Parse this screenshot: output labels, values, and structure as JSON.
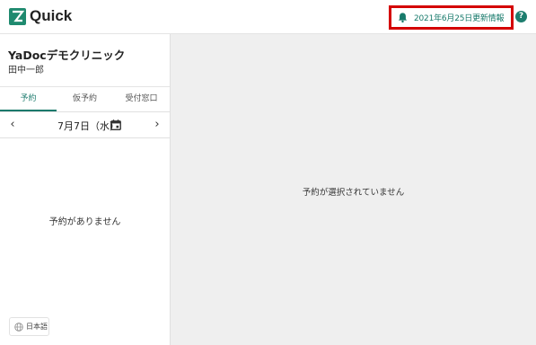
{
  "header": {
    "brand": "Quick",
    "notice": "2021年6月25日更新情報",
    "help_symbol": "?"
  },
  "sidebar": {
    "clinic_name": "YaDocデモクリニック",
    "user_name": "田中一郎",
    "tabs": [
      {
        "label": "予約",
        "active": true
      },
      {
        "label": "仮予約",
        "active": false
      },
      {
        "label": "受付窓口",
        "active": false
      }
    ],
    "date_label": "7月7日（水）",
    "prev_symbol": "‹",
    "next_symbol": "›",
    "empty_message": "予約がありません",
    "language": "日本語"
  },
  "main": {
    "empty_message": "予約が選択されていません"
  },
  "colors": {
    "accent": "#1b7a6c",
    "highlight_border": "#d40000",
    "panel_bg": "#efefef"
  },
  "icons": [
    "logo-icon",
    "bell-icon",
    "help-icon",
    "chevron-left-icon",
    "chevron-right-icon",
    "calendar-icon",
    "globe-icon"
  ]
}
